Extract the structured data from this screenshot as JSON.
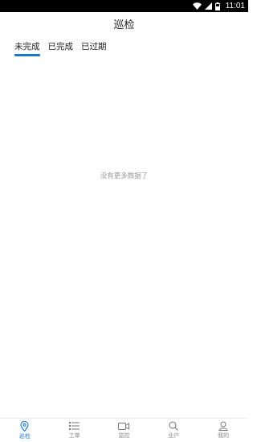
{
  "status_bar": {
    "time": "11:01",
    "icons": [
      "wifi-icon",
      "signal-icon",
      "battery-icon"
    ]
  },
  "header": {
    "title": "巡检"
  },
  "tabs": [
    {
      "label": "未完成",
      "active": true
    },
    {
      "label": "已完成",
      "active": false
    },
    {
      "label": "已过期",
      "active": false
    }
  ],
  "main": {
    "empty_message": "没有更多数据了"
  },
  "bottom_nav": [
    {
      "label": "巡检",
      "icon": "location-pin-icon",
      "active": true
    },
    {
      "label": "工单",
      "icon": "list-icon",
      "active": false
    },
    {
      "label": "监控",
      "icon": "video-camera-icon",
      "active": false
    },
    {
      "label": "业户",
      "icon": "search-icon",
      "active": false
    },
    {
      "label": "我的",
      "icon": "user-icon",
      "active": false
    }
  ],
  "colors": {
    "accent": "#1976d2",
    "inactive": "#888888",
    "status_bar": "#000000"
  }
}
